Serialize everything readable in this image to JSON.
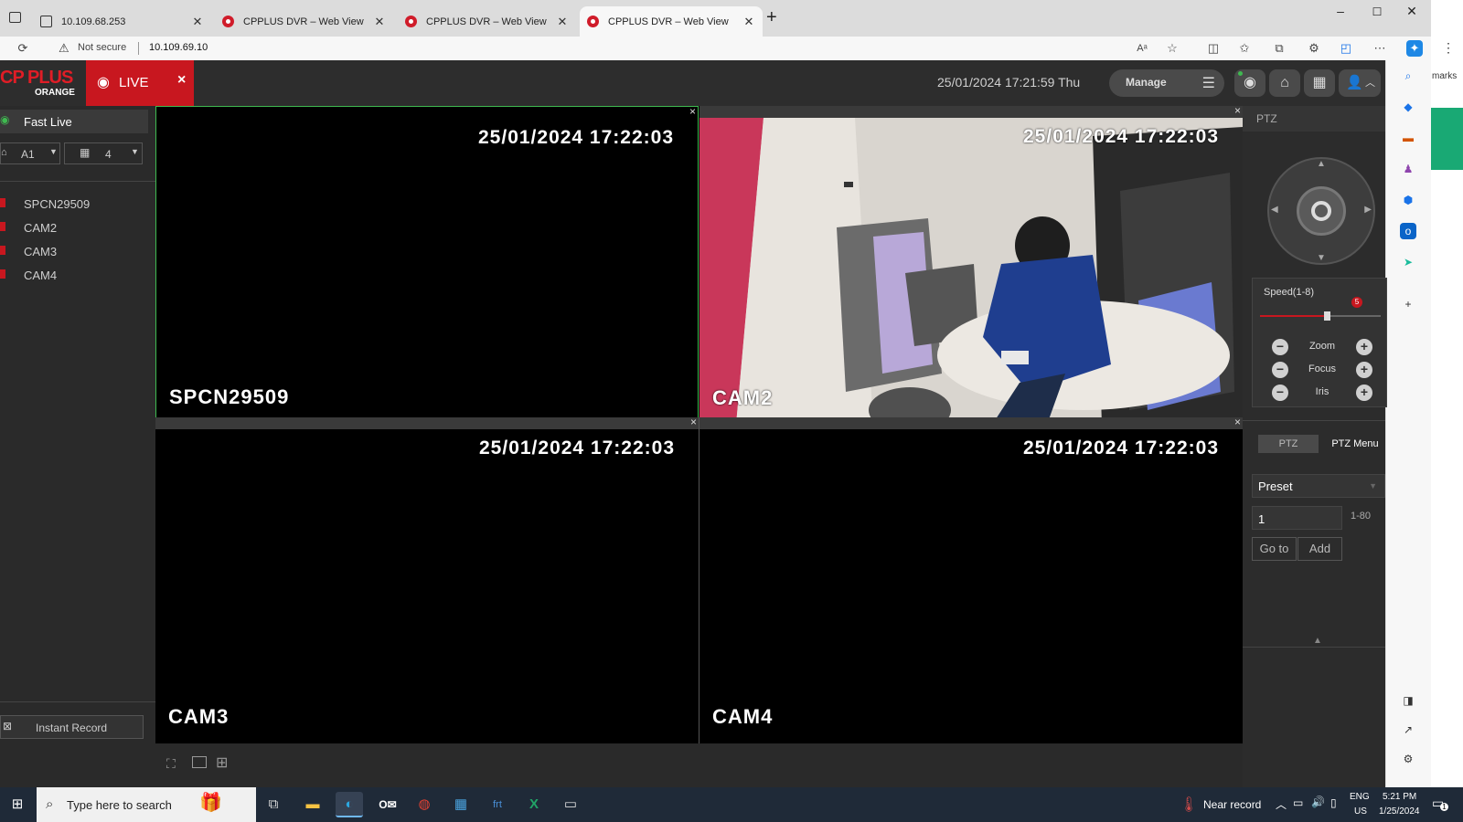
{
  "browser": {
    "tabs": [
      {
        "title": "10.109.68.253",
        "active": false
      },
      {
        "title": "CPPLUS DVR – Web View",
        "active": false
      },
      {
        "title": "CPPLUS DVR – Web View",
        "active": false
      },
      {
        "title": "CPPLUS DVR – Web View",
        "active": true
      }
    ],
    "new_tab": "+",
    "window_controls": {
      "minimize": "–",
      "maximize": "☐",
      "close": "✕"
    },
    "security": "Not secure",
    "url": "10.109.69.10",
    "side_text": "marks"
  },
  "dvr": {
    "logo_main": "CP PLUS",
    "logo_sub": "ORANGE",
    "live_label": "LIVE",
    "live_close": "×",
    "datetime": "25/01/2024 17:21:59 Thu",
    "manage_label": "Manage"
  },
  "left_panel": {
    "fast_live": "Fast Live",
    "group_label": "A1",
    "layout_count": "4",
    "cameras": [
      "SPCN29509",
      "CAM2",
      "CAM3",
      "CAM4"
    ],
    "instant_record": "Instant Record"
  },
  "video": {
    "cells": [
      {
        "name": "SPCN29509",
        "timestamp": "25/01/2024 17:22:03"
      },
      {
        "name": "CAM2",
        "timestamp": "25/01/2024 17:22:03"
      },
      {
        "name": "CAM3",
        "timestamp": "25/01/2024 17:22:03"
      },
      {
        "name": "CAM4",
        "timestamp": "25/01/2024 17:22:03"
      }
    ],
    "close_glyph": "×"
  },
  "ptz": {
    "title": "PTZ",
    "speed_label": "Speed(1-8)",
    "speed_value": "5",
    "speed_fraction": 0.55,
    "zoom_label": "Zoom",
    "focus_label": "Focus",
    "iris_label": "Iris",
    "minus": "−",
    "plus": "+",
    "tab_ptz": "PTZ",
    "tab_menu": "PTZ Menu",
    "preset_label": "Preset",
    "preset_value": "1",
    "preset_range": "1-80",
    "goto_label": "Go to",
    "add_label": "Add"
  },
  "taskbar": {
    "search_placeholder": "Type here to search",
    "weather": "Near record",
    "lang_top": "ENG",
    "lang_bottom": "US",
    "time": "5:21 PM",
    "date": "1/25/2024",
    "notif_count": "1"
  },
  "colors": {
    "accent_red": "#c8171f",
    "green_select": "#3fb950"
  }
}
